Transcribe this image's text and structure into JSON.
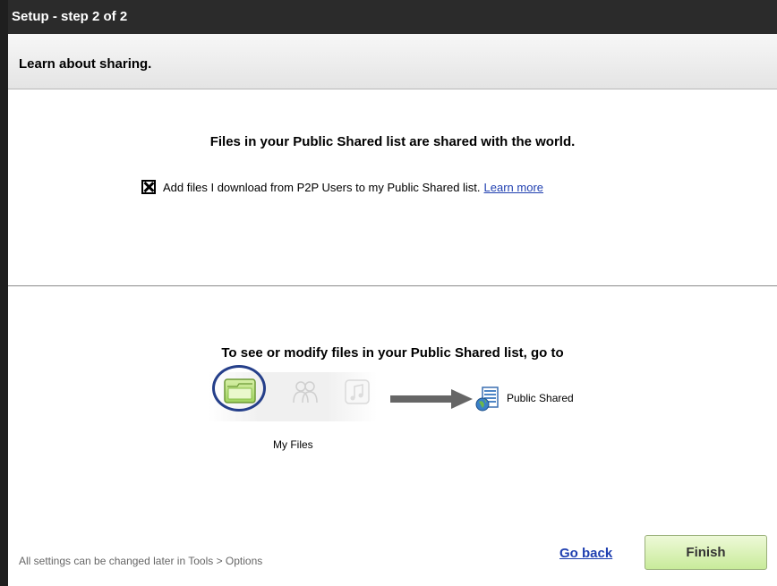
{
  "window": {
    "title": "Setup - step 2 of 2"
  },
  "header": {
    "subtitle": "Learn about sharing."
  },
  "sharing": {
    "heading": "Files in your Public Shared list are shared with the world.",
    "option": {
      "checked": true,
      "label": "Add files I download from P2P Users to my Public Shared list.",
      "link": "Learn more"
    }
  },
  "navigation_hint": {
    "heading": "To see or modify files in your Public Shared list, go to",
    "toolbar_icons": [
      "folder-icon",
      "people-icon",
      "music-icon"
    ],
    "toolbar_label": "My Files",
    "destination": "Public Shared",
    "destination_icon": "public-shared-document-icon"
  },
  "footer": {
    "note": "All settings can be changed later in Tools > Options",
    "back_label": "Go back",
    "finish_label": "Finish"
  },
  "colors": {
    "titlebar": "#2b2b2b",
    "link": "#1f3fb0",
    "highlight_ring": "#253f8a",
    "finish_button": "#d4f0aa"
  }
}
